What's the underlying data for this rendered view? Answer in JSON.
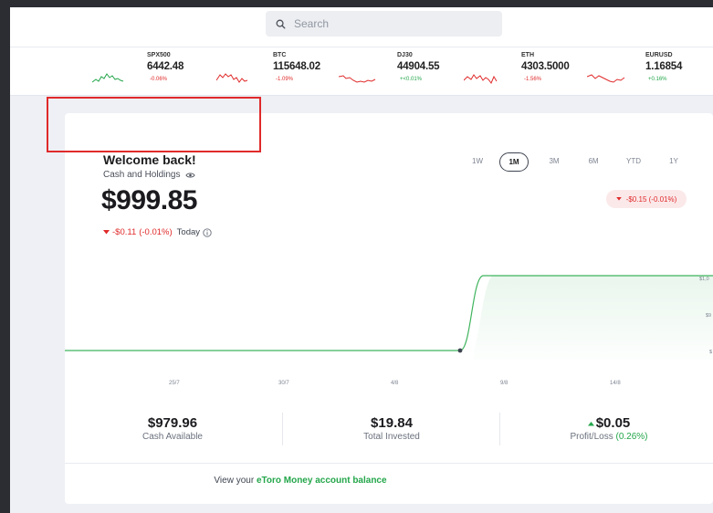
{
  "search": {
    "placeholder": "Search"
  },
  "tickers": [
    {
      "symbol": "SPX500",
      "price": "6442.48",
      "change": "-0.06%",
      "trend": "up"
    },
    {
      "symbol": "BTC",
      "price": "115648.02",
      "change": "-1.09%",
      "trend": "down"
    },
    {
      "symbol": "DJ30",
      "price": "44904.55",
      "change": "+<0.01%",
      "trend": "up"
    },
    {
      "symbol": "ETH",
      "price": "4303.5000",
      "change": "-1.56%",
      "trend": "down"
    },
    {
      "symbol": "EURUSD",
      "price": "1.16854",
      "change": "+0.16%",
      "trend": "up"
    }
  ],
  "portfolio": {
    "welcome": "Welcome back!",
    "cash_label": "Cash and Holdings",
    "balance": "$999.85",
    "day_change": "-$0.11",
    "day_change_pct": "(-0.01%)",
    "today_label": "Today"
  },
  "periods": [
    "1W",
    "1M",
    "3M",
    "6M",
    "YTD",
    "1Y"
  ],
  "active_period": "1M",
  "range_change": "-$0.15 (-0.01%)",
  "chart_labels": {
    "x": [
      "25/7",
      "30/7",
      "4/8",
      "9/8",
      "14/8"
    ],
    "y": [
      "$1,0",
      "$9",
      "$"
    ]
  },
  "chart_data": {
    "type": "line",
    "x": [
      "25/7",
      "30/7",
      "4/8",
      "9/8",
      "14/8"
    ],
    "series": [
      {
        "values": [
          979.96,
          979.96,
          979.96,
          999.85,
          999.85
        ]
      }
    ]
  },
  "summary": {
    "cash_available_value": "$979.96",
    "cash_available_label": "Cash Available",
    "total_invested_value": "$19.84",
    "total_invested_label": "Total Invested",
    "profit_value": "$0.05",
    "profit_label": "Profit/Loss",
    "profit_pct": "(0.26%)"
  },
  "footer": {
    "prefix": "View your ",
    "link": "eToro Money account balance"
  },
  "colors": {
    "accent_green": "#23a64a",
    "negative_red": "#e02a2a",
    "highlight_red": "#e02a2a"
  }
}
